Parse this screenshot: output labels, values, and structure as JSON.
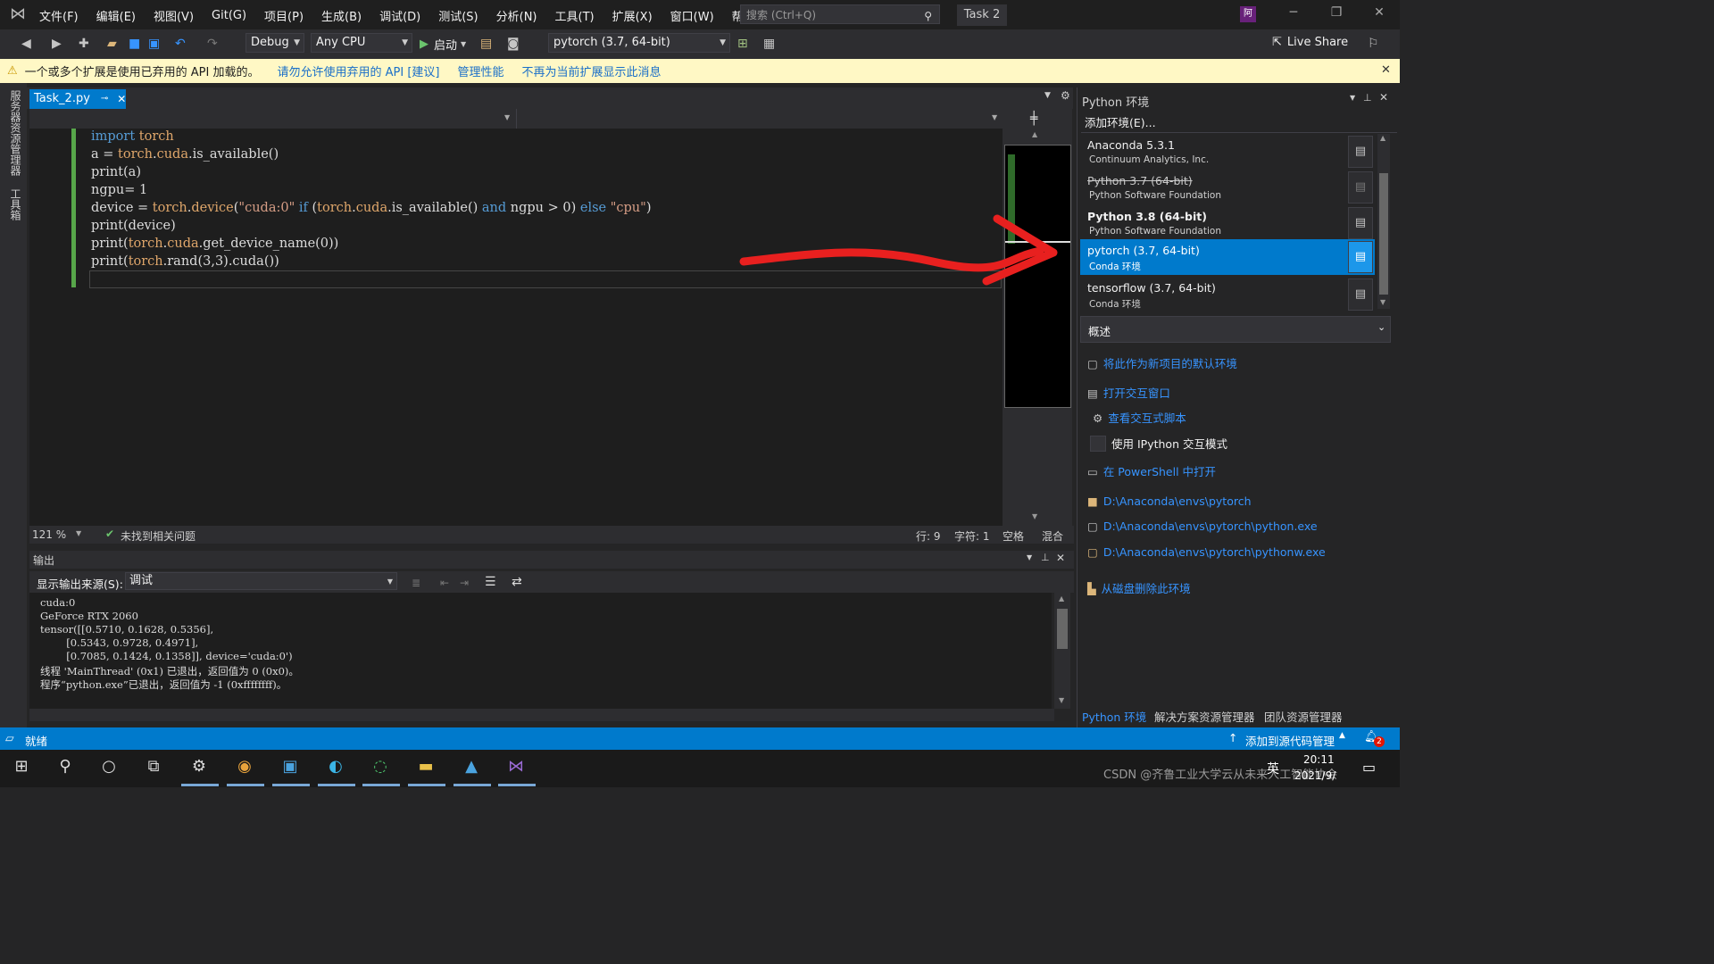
{
  "menu": [
    "文件(F)",
    "编辑(E)",
    "视图(V)",
    "Git(G)",
    "项目(P)",
    "生成(B)",
    "调试(D)",
    "测试(S)",
    "分析(N)",
    "工具(T)",
    "扩展(X)",
    "窗口(W)",
    "帮助(H)"
  ],
  "search_placeholder": "搜索 (Ctrl+Q)",
  "task_title": "Task 2",
  "avatar_initial": "阿",
  "toolbar": {
    "config": "Debug",
    "platform": "Any CPU",
    "start_label": "启动",
    "env_combo": "pytorch (3.7, 64-bit)",
    "live_share": "Live Share"
  },
  "infobar": {
    "message": "一个或多个扩展是使用已弃用的 API 加载的。",
    "link1": "请勿允许使用弃用的 API [建议]",
    "link2": "管理性能",
    "link3": "不再为当前扩展显示此消息"
  },
  "left_tabs": [
    "服务器资源管理器",
    "工具箱"
  ],
  "editor": {
    "tab_name": "Task_2.py",
    "zoom": "121 %",
    "issues": "未找到相关问题",
    "row": "行: 9",
    "col": "字符: 1",
    "space": "空格",
    "mixed": "混合"
  },
  "output": {
    "title": "输出",
    "source_label": "显示输出来源(S):",
    "source_value": "调试",
    "lines": [
      "cuda:0",
      "GeForce RTX 2060",
      "tensor([[0.5710, 0.1628, 0.5356],",
      "        [0.5343, 0.9728, 0.4971],",
      "        [0.7085, 0.1424, 0.1358]], device='cuda:0')",
      "线程 'MainThread' (0x1) 已退出，返回值为 0 (0x0)。",
      "程序“python.exe”已退出，返回值为 -1 (0xffffffff)。"
    ]
  },
  "python_env": {
    "title": "Python 环境",
    "add_env": "添加环境(E)...",
    "envs": [
      {
        "name": "Anaconda 5.3.1",
        "sub": "Continuum Analytics, Inc."
      },
      {
        "name": "Python 3.7 (64-bit)",
        "sub": "Python Software Foundation"
      },
      {
        "name": "Python 3.8 (64-bit)",
        "sub": "Python Software Foundation"
      },
      {
        "name": "pytorch (3.7, 64-bit)",
        "sub": "Conda 环境"
      },
      {
        "name": "tensorflow (3.7, 64-bit)",
        "sub": "Conda 环境"
      }
    ],
    "overview": "概述",
    "actions": {
      "set_default": "将此作为新项目的默认环境",
      "open_interactive": "打开交互窗口",
      "view_scripts": "查看交互式脚本",
      "use_ipython": "使用 IPython 交互模式",
      "open_powershell": "在 PowerShell 中打开",
      "path_env": "D:\\Anaconda\\envs\\pytorch",
      "path_python": "D:\\Anaconda\\envs\\pytorch\\python.exe",
      "path_pythonw": "D:\\Anaconda\\envs\\pytorch\\pythonw.exe",
      "delete_env": "从磁盘删除此环境"
    },
    "bottom_tabs": [
      "Python 环境",
      "解决方案资源管理器",
      "团队资源管理器"
    ]
  },
  "statusbar": {
    "ready": "就绪",
    "add_source": "添加到源代码管理",
    "notifications": "2"
  },
  "taskbar": {
    "time": "20:11",
    "date": "2021/9/",
    "lang": "英",
    "watermark": "CSDN @齐鲁工业大学云从未来人工智能协会"
  }
}
